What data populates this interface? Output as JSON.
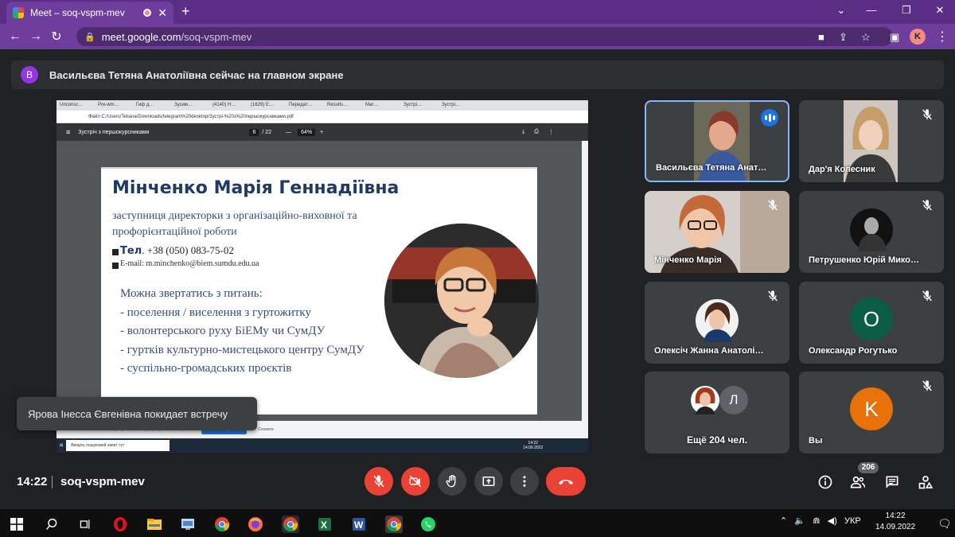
{
  "browser": {
    "tab_title": "Meet – soq-vspm-mev",
    "url_domain": "meet.google.com",
    "url_path": "/soq-vspm-mev",
    "profile_letter": "K"
  },
  "banner": {
    "avatar_letter": "В",
    "text": "Васильєва Тетяна Анатоліївна сейчас на главном экране"
  },
  "shared_screen": {
    "tabs": [
      "Unconsc…",
      "Pre-wm…",
      "Гиф д…",
      "Зусим…",
      "(4140) H…",
      "(1629) E…",
      "Передат…",
      "Results…",
      "Mar…",
      "Зустрі…",
      "Зустрі…"
    ],
    "address": "Файл  C:/Users/Tetiana/Downloads/telegram%20desktop/Зустрі-%20з%20першокурсниками.pdf",
    "pdf_title": "Зустріч з першокурсниками",
    "pdf_page": "6",
    "pdf_pages": "/ 22",
    "pdf_zoom": "64%",
    "slide": {
      "name": "Мінченко Марія Геннадіївна",
      "role_line1": "заступниця директорки з організаційно-виховної та",
      "role_line2": "профорієнтаційної роботи",
      "phone_label": "Тел",
      "phone": ". +38 (050) 083-75-02",
      "email": "E-mail:  m.minchenko@biem.sumdu.edu.ua",
      "topics_heading": "Можна звертатись з питань:",
      "topics": [
        "- поселення / виселення з гуртожитку",
        "- волонтерського руху БіЕМу чи СумДУ",
        "- гуртків культурно-мистецького центру СумДУ",
        "- суспільно-громадських проєктів"
      ]
    },
    "status_text": "meet.google.com має доступ до вашого екрана",
    "status_button": "Більше не ділитися",
    "status_hide": "Сховати",
    "search_placeholder": "Вводіть пошуковий запит тут",
    "clock_time": "14:22",
    "clock_date": "14.09.2022"
  },
  "toast": "Ярова Інесса Євгенівна покидает встречу",
  "participants": [
    {
      "name": "Васильєва Тетяна Анат…",
      "speaking": true
    },
    {
      "name": "Дар'я Колесник",
      "muted": true
    },
    {
      "name": "Мінченко Марія",
      "muted": true
    },
    {
      "name": "Петрушенко Юрій Мико…",
      "muted": true
    },
    {
      "name": "Олексіч Жанна Анатолі…",
      "muted": true
    },
    {
      "name": "Олександр Рогутько",
      "muted": true,
      "letter": "O",
      "color": "#0b5d45"
    },
    {
      "name": "Ещё 204 чел.",
      "letter": "Л",
      "color": "#5f6368"
    },
    {
      "name": "Вы",
      "muted": true,
      "letter": "K",
      "color": "#e8710a"
    }
  ],
  "meeting": {
    "time": "14:22",
    "code": "soq-vspm-mev",
    "participant_count": "206"
  },
  "taskbar": {
    "lang": "УКР",
    "time": "14:22",
    "date": "14.09.2022"
  },
  "colors": {
    "end_call": "#ea4335",
    "speaking": "#1a73e8",
    "chrome": "#6f3d9c"
  }
}
